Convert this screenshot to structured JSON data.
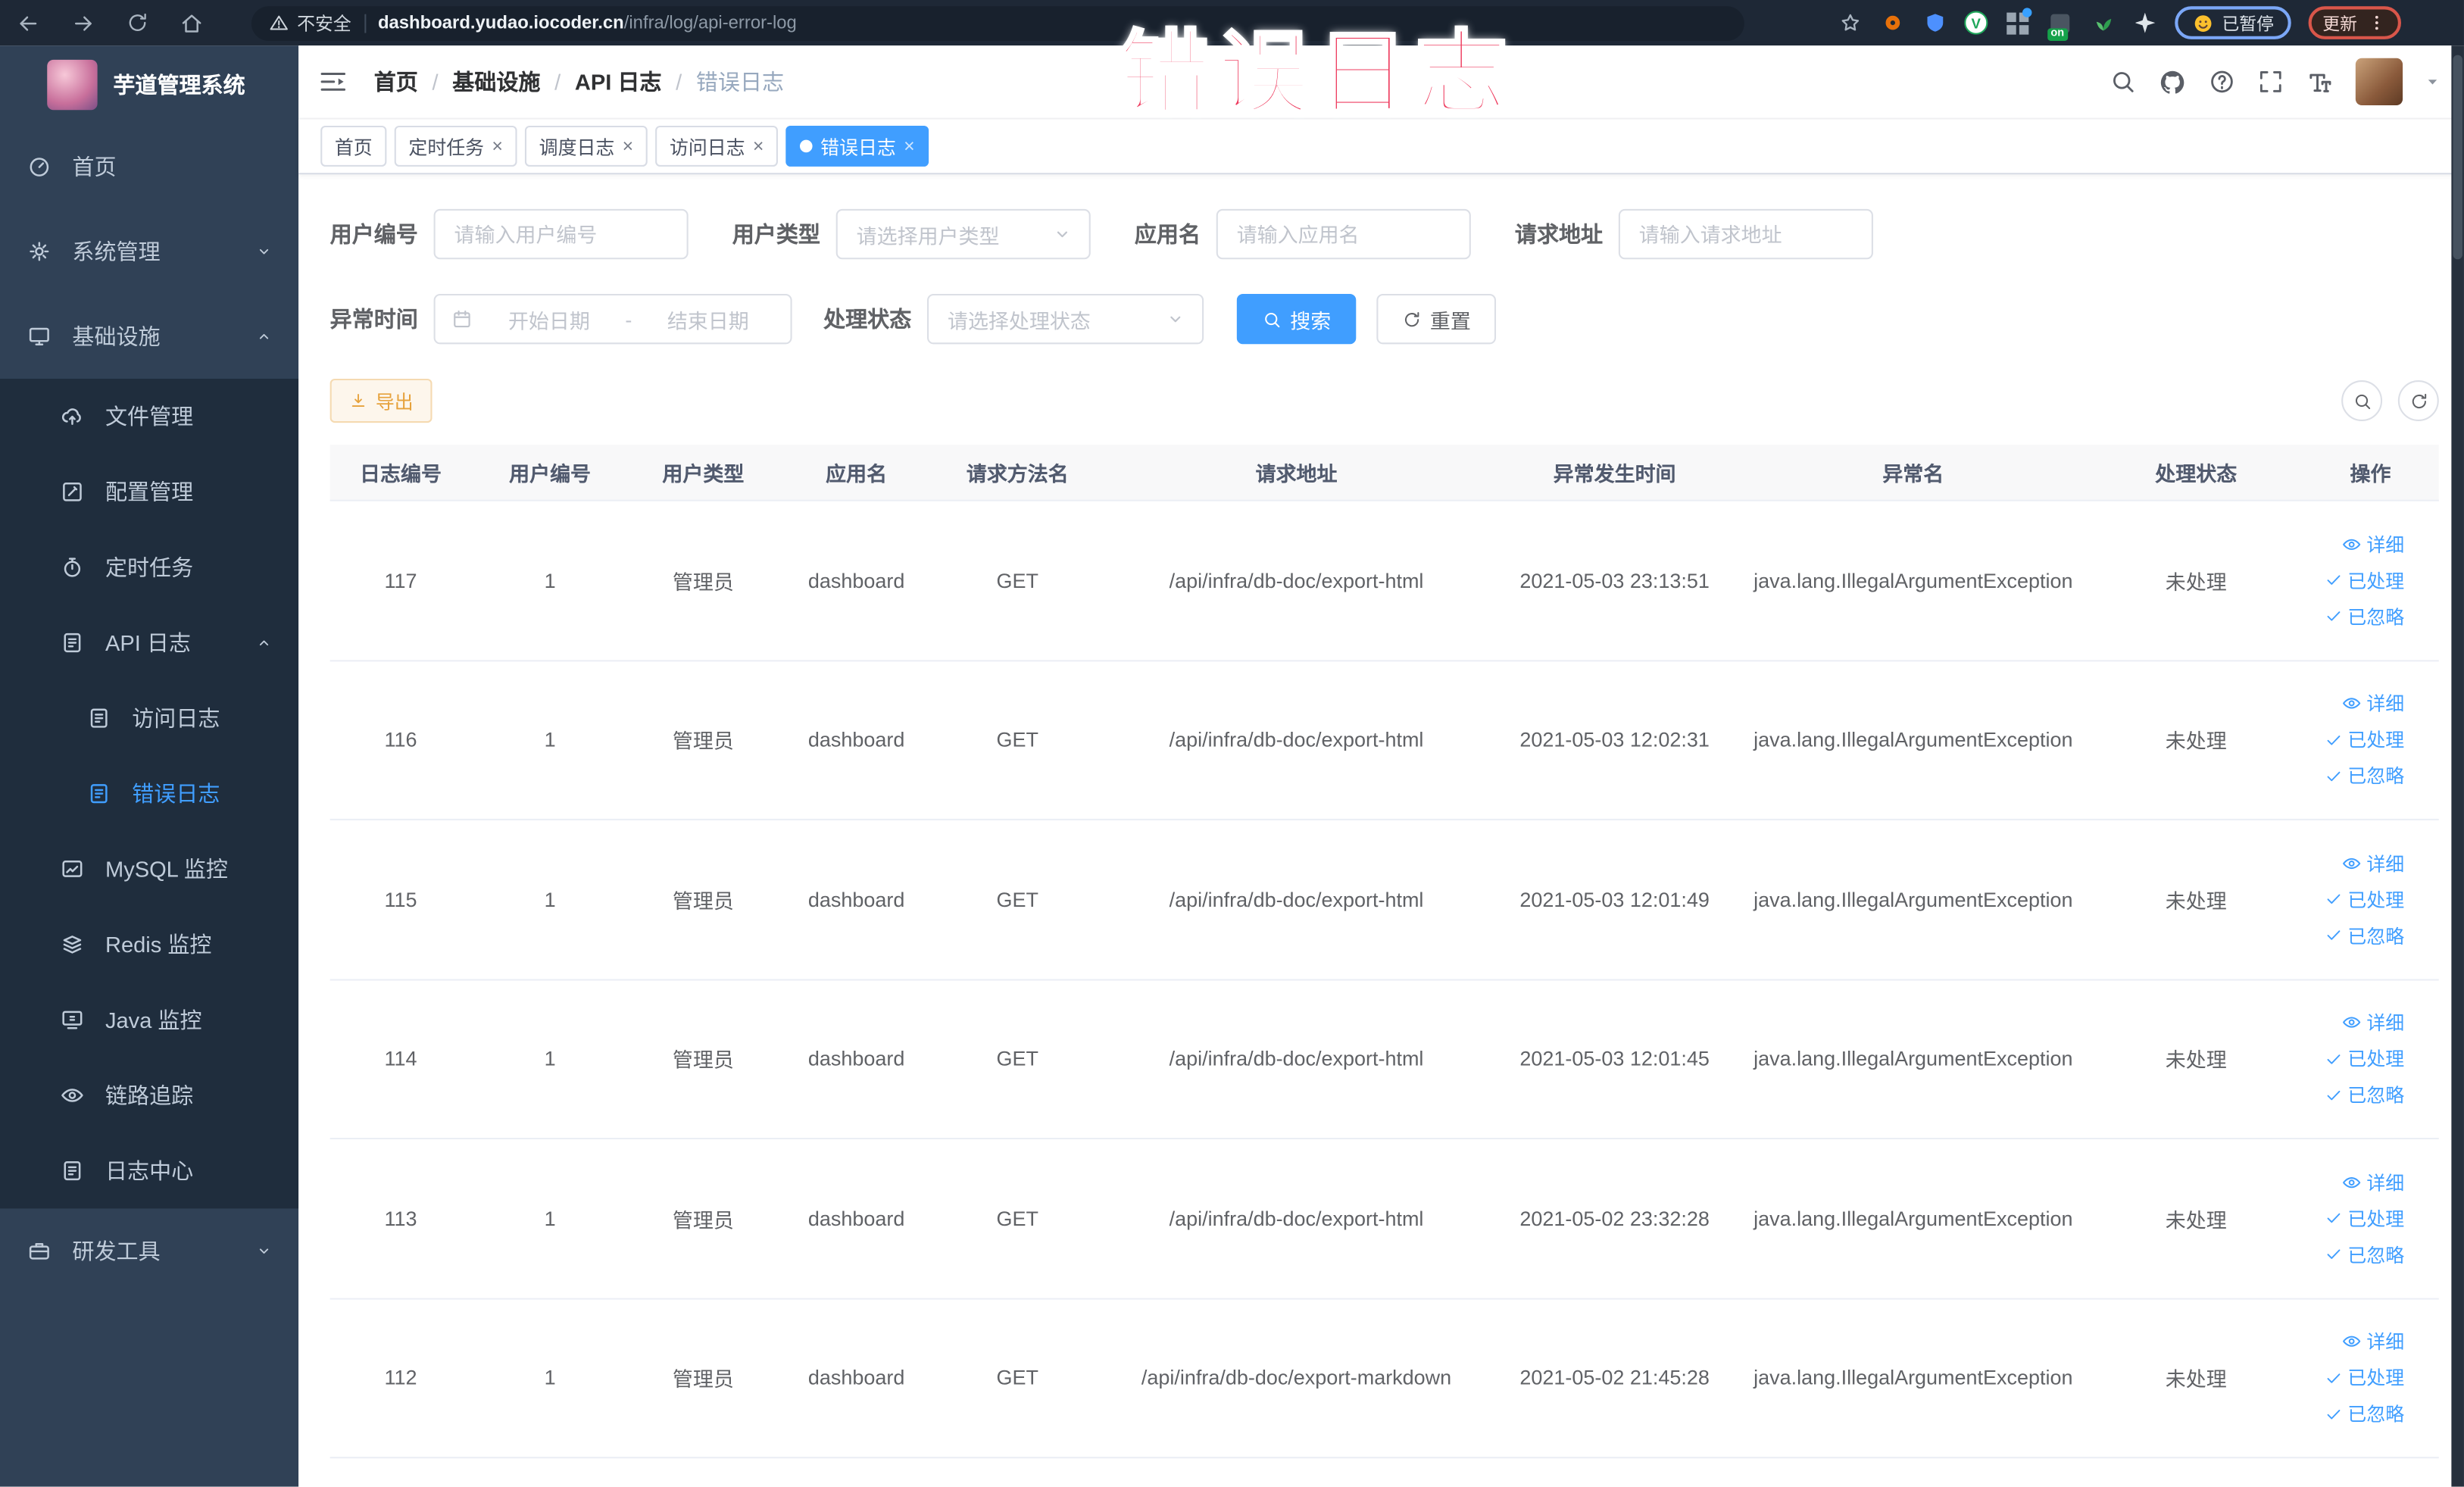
{
  "browser": {
    "security_label": "不安全",
    "url_host": "dashboard.yudao.iocoder.cn",
    "url_path": "/infra/log/api-error-log",
    "paused_badge": "已暂停",
    "update_button": "更新",
    "extension_badge": "on",
    "nav_icons": [
      "back-icon",
      "forward-icon",
      "reload-icon",
      "home-icon"
    ],
    "extension_icons": [
      "bookmark-star-icon",
      "orange-ring-extension-icon",
      "blue-shield-extension-icon",
      "green-v-extension-icon",
      "grid-extension-icon",
      "on-badge-extension-icon",
      "sprout-extension-icon",
      "pinwheel-extension-icon"
    ]
  },
  "annotation": {
    "text": "错误日志"
  },
  "sidebar": {
    "title": "芋道管理系统",
    "items": [
      {
        "key": "home",
        "label": "首页",
        "icon": "dashboard-icon",
        "level": 1
      },
      {
        "key": "system",
        "label": "系统管理",
        "icon": "gear-icon",
        "level": 1,
        "chevron": "down"
      },
      {
        "key": "infra",
        "label": "基础设施",
        "icon": "infra-icon",
        "level": 1,
        "chevron": "up"
      },
      {
        "key": "file",
        "label": "文件管理",
        "icon": "cloud-upload-icon",
        "level": 2
      },
      {
        "key": "config",
        "label": "配置管理",
        "icon": "edit-square-icon",
        "level": 2
      },
      {
        "key": "job",
        "label": "定时任务",
        "icon": "timer-icon",
        "level": 2
      },
      {
        "key": "api-log",
        "label": "API 日志",
        "icon": "log-icon",
        "level": 2,
        "chevron": "up"
      },
      {
        "key": "access-log",
        "label": "访问日志",
        "icon": "log-icon",
        "level": 3
      },
      {
        "key": "error-log",
        "label": "错误日志",
        "icon": "log-icon",
        "level": 3,
        "active": true
      },
      {
        "key": "mysql",
        "label": "MySQL 监控",
        "icon": "chart-icon",
        "level": 2
      },
      {
        "key": "redis",
        "label": "Redis 监控",
        "icon": "stack-icon",
        "level": 2
      },
      {
        "key": "java",
        "label": "Java 监控",
        "icon": "monitor-icon",
        "level": 2
      },
      {
        "key": "trace",
        "label": "链路追踪",
        "icon": "eye-icon",
        "level": 2
      },
      {
        "key": "log-center",
        "label": "日志中心",
        "icon": "log-icon",
        "level": 2
      },
      {
        "key": "devtools",
        "label": "研发工具",
        "icon": "briefcase-icon",
        "level": 1,
        "chevron": "down"
      }
    ]
  },
  "breadcrumb": {
    "items": [
      "首页",
      "基础设施",
      "API 日志",
      "错误日志"
    ]
  },
  "navbar_icons": [
    "search-icon",
    "github-icon",
    "help-icon",
    "fullscreen-icon",
    "font-size-icon",
    "avatar",
    "chevron-down-icon"
  ],
  "tags": [
    {
      "label": "首页",
      "closable": false,
      "active": false
    },
    {
      "label": "定时任务",
      "closable": true,
      "active": false
    },
    {
      "label": "调度日志",
      "closable": true,
      "active": false
    },
    {
      "label": "访问日志",
      "closable": true,
      "active": false
    },
    {
      "label": "错误日志",
      "closable": true,
      "active": true
    }
  ],
  "filters": {
    "user_id": {
      "label": "用户编号",
      "placeholder": "请输入用户编号"
    },
    "user_type": {
      "label": "用户类型",
      "placeholder": "请选择用户类型"
    },
    "app_name": {
      "label": "应用名",
      "placeholder": "请输入应用名"
    },
    "request_url": {
      "label": "请求地址",
      "placeholder": "请输入请求地址"
    },
    "exception_time": {
      "label": "异常时间",
      "start_placeholder": "开始日期",
      "separator": "-",
      "end_placeholder": "结束日期"
    },
    "process_status": {
      "label": "处理状态",
      "placeholder": "请选择处理状态"
    },
    "search_button": "搜索",
    "reset_button": "重置"
  },
  "toolbar": {
    "export_button": "导出"
  },
  "table": {
    "columns": [
      "日志编号",
      "用户编号",
      "用户类型",
      "应用名",
      "请求方法名",
      "请求地址",
      "异常发生时间",
      "异常名",
      "处理状态",
      "操作"
    ],
    "actions": [
      {
        "name": "detail",
        "label": "详细",
        "icon": "eye"
      },
      {
        "name": "processed",
        "label": "已处理",
        "icon": "check"
      },
      {
        "name": "ignored",
        "label": "已忽略",
        "icon": "check"
      }
    ],
    "rows": [
      {
        "id": "117",
        "user_id": "1",
        "user_type": "管理员",
        "app": "dashboard",
        "method": "GET",
        "url": "/api/infra/db-doc/export-html",
        "time": "2021-05-03 23:13:51",
        "exception": "java.lang.IllegalArgumentException",
        "status": "未处理"
      },
      {
        "id": "116",
        "user_id": "1",
        "user_type": "管理员",
        "app": "dashboard",
        "method": "GET",
        "url": "/api/infra/db-doc/export-html",
        "time": "2021-05-03 12:02:31",
        "exception": "java.lang.IllegalArgumentException",
        "status": "未处理"
      },
      {
        "id": "115",
        "user_id": "1",
        "user_type": "管理员",
        "app": "dashboard",
        "method": "GET",
        "url": "/api/infra/db-doc/export-html",
        "time": "2021-05-03 12:01:49",
        "exception": "java.lang.IllegalArgumentException",
        "status": "未处理"
      },
      {
        "id": "114",
        "user_id": "1",
        "user_type": "管理员",
        "app": "dashboard",
        "method": "GET",
        "url": "/api/infra/db-doc/export-html",
        "time": "2021-05-03 12:01:45",
        "exception": "java.lang.IllegalArgumentException",
        "status": "未处理"
      },
      {
        "id": "113",
        "user_id": "1",
        "user_type": "管理员",
        "app": "dashboard",
        "method": "GET",
        "url": "/api/infra/db-doc/export-html",
        "time": "2021-05-02 23:32:28",
        "exception": "java.lang.IllegalArgumentException",
        "status": "未处理"
      },
      {
        "id": "112",
        "user_id": "1",
        "user_type": "管理员",
        "app": "dashboard",
        "method": "GET",
        "url": "/api/infra/db-doc/export-markdown",
        "time": "2021-05-02 21:45:28",
        "exception": "java.lang.IllegalArgumentException",
        "status": "未处理"
      }
    ]
  },
  "colors": {
    "accent": "#409eff",
    "warning": "#e6a23c",
    "annotation_red": "#ee3b5e",
    "sidebar_bg": "#304156",
    "submenu_bg": "#1f2d3d",
    "chrome_bg": "#1e2836",
    "table_header_text": "#515a6e"
  }
}
